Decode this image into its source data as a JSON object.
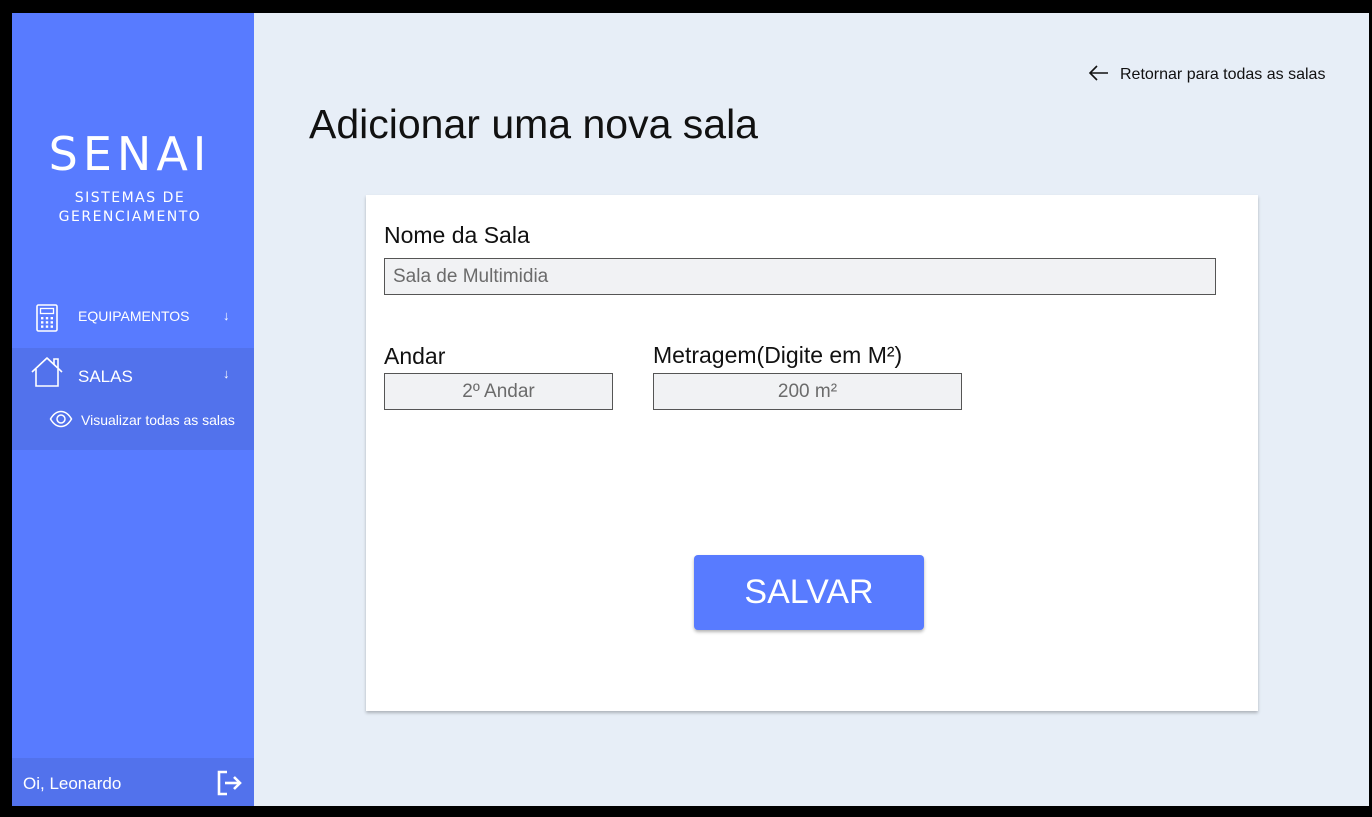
{
  "sidebar": {
    "logo_main": "SENAI",
    "logo_sub_line1": "SISTEMAS DE",
    "logo_sub_line2": "GERENCIAMENTO",
    "nav": {
      "equipamentos_label": "EQUIPAMENTOS",
      "salas_label": "SALAS",
      "view_all_label": "Visualizar todas as salas"
    },
    "arrow_glyph": "↓",
    "greeting": "Oi, Leonardo",
    "icons": [
      "calculator-icon",
      "house-icon",
      "eye-icon",
      "logout-icon",
      "arrow-down-icon"
    ]
  },
  "header": {
    "back_link": "Retornar para todas as salas",
    "title": "Adicionar uma nova sala"
  },
  "form": {
    "nome": {
      "label": "Nome da Sala",
      "value": "Sala de Multimidia"
    },
    "andar": {
      "label": "Andar",
      "value": "2º Andar"
    },
    "metragem": {
      "label": "Metragem(Digite em M²)",
      "value": "200 m²"
    },
    "save_label": "SALVAR"
  },
  "colors": {
    "sidebar": "#587bff",
    "sidebar_active": "#5272ec",
    "background": "#e7eef7",
    "button": "#587bff"
  }
}
